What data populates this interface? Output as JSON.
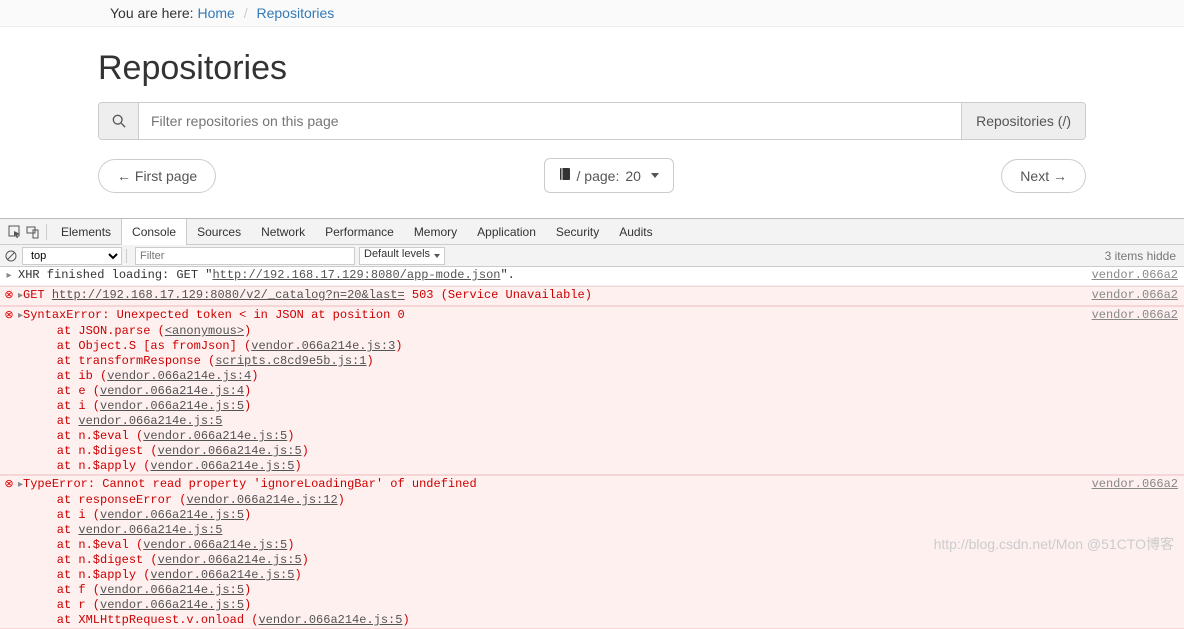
{
  "breadcrumb": {
    "prefix": "You are here:",
    "home": "Home",
    "current": "Repositories"
  },
  "page": {
    "title": "Repositories",
    "filter_placeholder": "Filter repositories on this page",
    "addon": "Repositories (/)",
    "first_page": "← First page",
    "per_page_prefix": "/ page: ",
    "per_page_value": "20",
    "next": "Next →"
  },
  "devtools": {
    "tabs": [
      "Elements",
      "Console",
      "Sources",
      "Network",
      "Performance",
      "Memory",
      "Application",
      "Security",
      "Audits"
    ],
    "active_tab": "Console",
    "context": "top",
    "filter_placeholder": "Filter",
    "levels": "Default levels",
    "hidden_msg": "3 items hidde"
  },
  "console": {
    "xhr_line_prefix": "XHR finished loading: GET \"",
    "xhr_url": "http://192.168.17.129:8080/app-mode.json",
    "xhr_line_suffix": "\".",
    "src_vendor": "vendor.066a2",
    "get_label": "GET",
    "get_url": "http://192.168.17.129:8080/v2/_catalog?n=20&last=",
    "get_status": " 503 (Service Unavailable)",
    "syntax_error": "SyntaxError: Unexpected token < in JSON at position 0",
    "stack1": [
      "    at JSON.parse (<anonymous>)",
      "    at Object.S [as fromJson] (vendor.066a214e.js:3)",
      "    at transformResponse (scripts.c8cd9e5b.js:1)",
      "    at ib (vendor.066a214e.js:4)",
      "    at e (vendor.066a214e.js:4)",
      "    at i (vendor.066a214e.js:5)",
      "    at vendor.066a214e.js:5",
      "    at n.$eval (vendor.066a214e.js:5)",
      "    at n.$digest (vendor.066a214e.js:5)",
      "    at n.$apply (vendor.066a214e.js:5)"
    ],
    "type_error": "TypeError: Cannot read property 'ignoreLoadingBar' of undefined",
    "stack2": [
      "    at responseError (vendor.066a214e.js:12)",
      "    at i (vendor.066a214e.js:5)",
      "    at vendor.066a214e.js:5",
      "    at n.$eval (vendor.066a214e.js:5)",
      "    at n.$digest (vendor.066a214e.js:5)",
      "    at n.$apply (vendor.066a214e.js:5)",
      "    at f (vendor.066a214e.js:5)",
      "    at r (vendor.066a214e.js:5)",
      "    at XMLHttpRequest.v.onload (vendor.066a214e.js:5)"
    ]
  },
  "watermark": "http://blog.csdn.net/Mon @51CTO博客"
}
